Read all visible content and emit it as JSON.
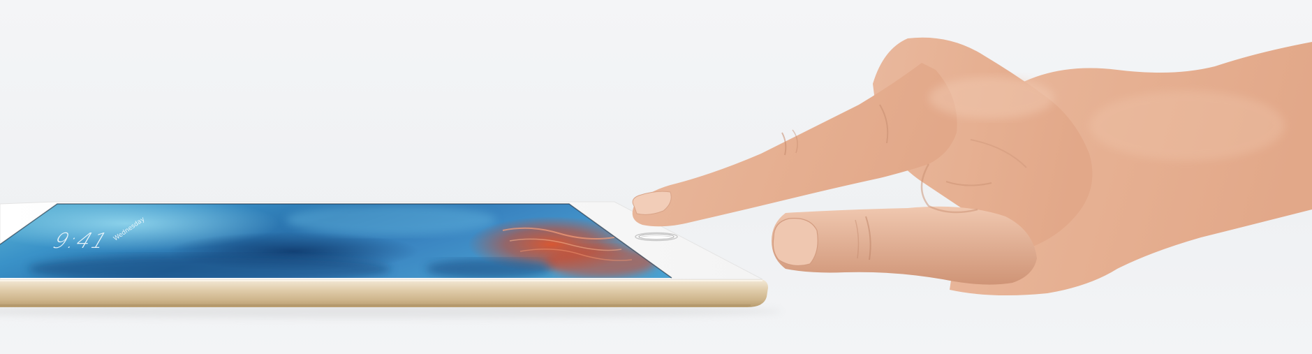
{
  "lock_screen": {
    "time": "9:41",
    "date": "Wednesday"
  },
  "colors": {
    "background": "#f1f3f5",
    "device_gold": "#d9c6a3",
    "device_face": "#fafafa",
    "screen_blue": "#2b7fb3",
    "skin": "#e8b69b"
  },
  "icons": {
    "device": "tablet-device-icon",
    "home_button": "home-button-icon",
    "hand": "hand-pointing-icon"
  }
}
